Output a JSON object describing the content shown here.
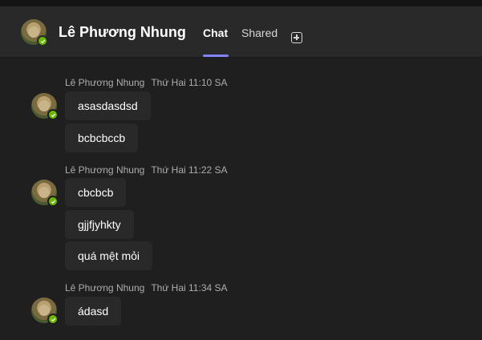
{
  "header": {
    "title": "Lê Phương Nhung",
    "tabs": [
      {
        "label": "Chat",
        "active": true
      },
      {
        "label": "Shared",
        "active": false
      }
    ],
    "add_tab_icon": "add-tab-icon",
    "presence": "available"
  },
  "messages": [
    {
      "sender": "Lê Phương Nhung",
      "time": "Thứ Hai 11:10 SA",
      "lines": [
        "asasdasdsd",
        "bcbcbccb"
      ]
    },
    {
      "sender": "Lê Phương Nhung",
      "time": "Thứ Hai 11:22 SA",
      "lines": [
        "cbcbcb",
        "gjjfjyhkty",
        "quá mệt mỏi"
      ]
    },
    {
      "sender": "Lê Phương Nhung",
      "time": "Thứ Hai 11:34 SA",
      "lines": [
        "ádasd"
      ]
    }
  ],
  "colors": {
    "accent": "#7f85f5",
    "presence": "#6bb700",
    "background": "#1f1f1f",
    "header": "#292929"
  }
}
